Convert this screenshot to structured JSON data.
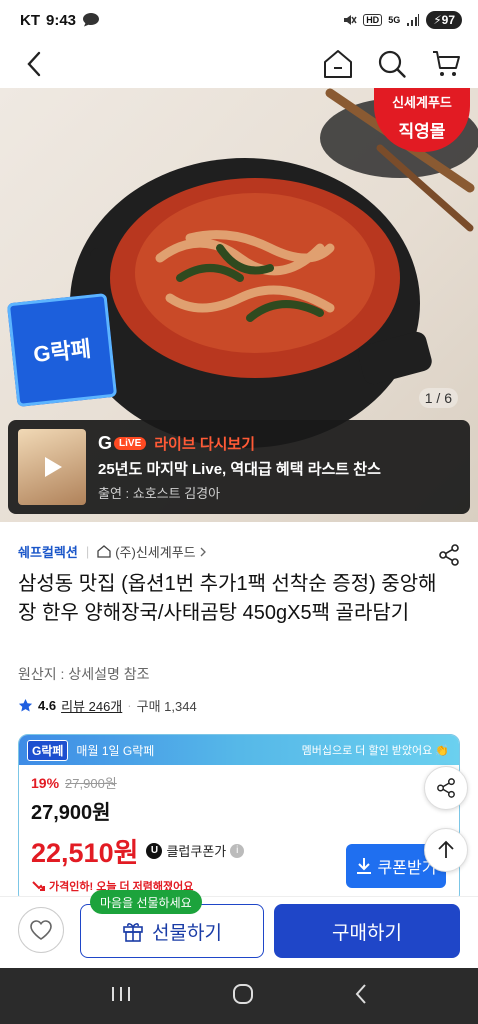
{
  "status_bar": {
    "carrier": "KT",
    "time": "9:43",
    "network": "5G",
    "hd": "HD",
    "battery": "97"
  },
  "hero": {
    "store_badge_line1": "신세계푸드",
    "store_badge_line2": "직영몰",
    "page_indicator": "1 / 6",
    "glakpe": "G락페"
  },
  "live": {
    "brand": "G",
    "live_pill": "LiVE",
    "tag": "라이브 다시보기",
    "title": "25년도 마지막 Live, 역대급 혜택 라스트 찬스",
    "host": "출연 : 쇼호스트 김경아"
  },
  "product": {
    "brand": "쉐프컬렉션",
    "seller": "(주)신세계푸드",
    "title": "삼성동 맛집 (옵션1번 추가1팩 선착순 증정) 중앙해장 한우 양해장국/사태곰탕 450gX5팩 골라담기",
    "origin": "원산지 : 상세설명 참조",
    "rating": "4.6",
    "reviews": "리뷰 246개",
    "purchases": "구매 1,344"
  },
  "price_card": {
    "badge": "G락페",
    "event": "매월 1일 G락페",
    "membership_note": "멤버십으로 더 할인 받았어요 👏",
    "discount": "19%",
    "original_price": "27,900원",
    "sale_price": "27,900원",
    "club_price": "22,510원",
    "club_label": "클럽쿠폰가",
    "coupon_button": "쿠폰받기",
    "lower_note": "가격인하! 오늘 더 저렴해졌어요"
  },
  "bottom_bar": {
    "gift_tooltip": "마음을 선물하세요",
    "gift_label": "선물하기",
    "buy_label": "구매하기"
  }
}
